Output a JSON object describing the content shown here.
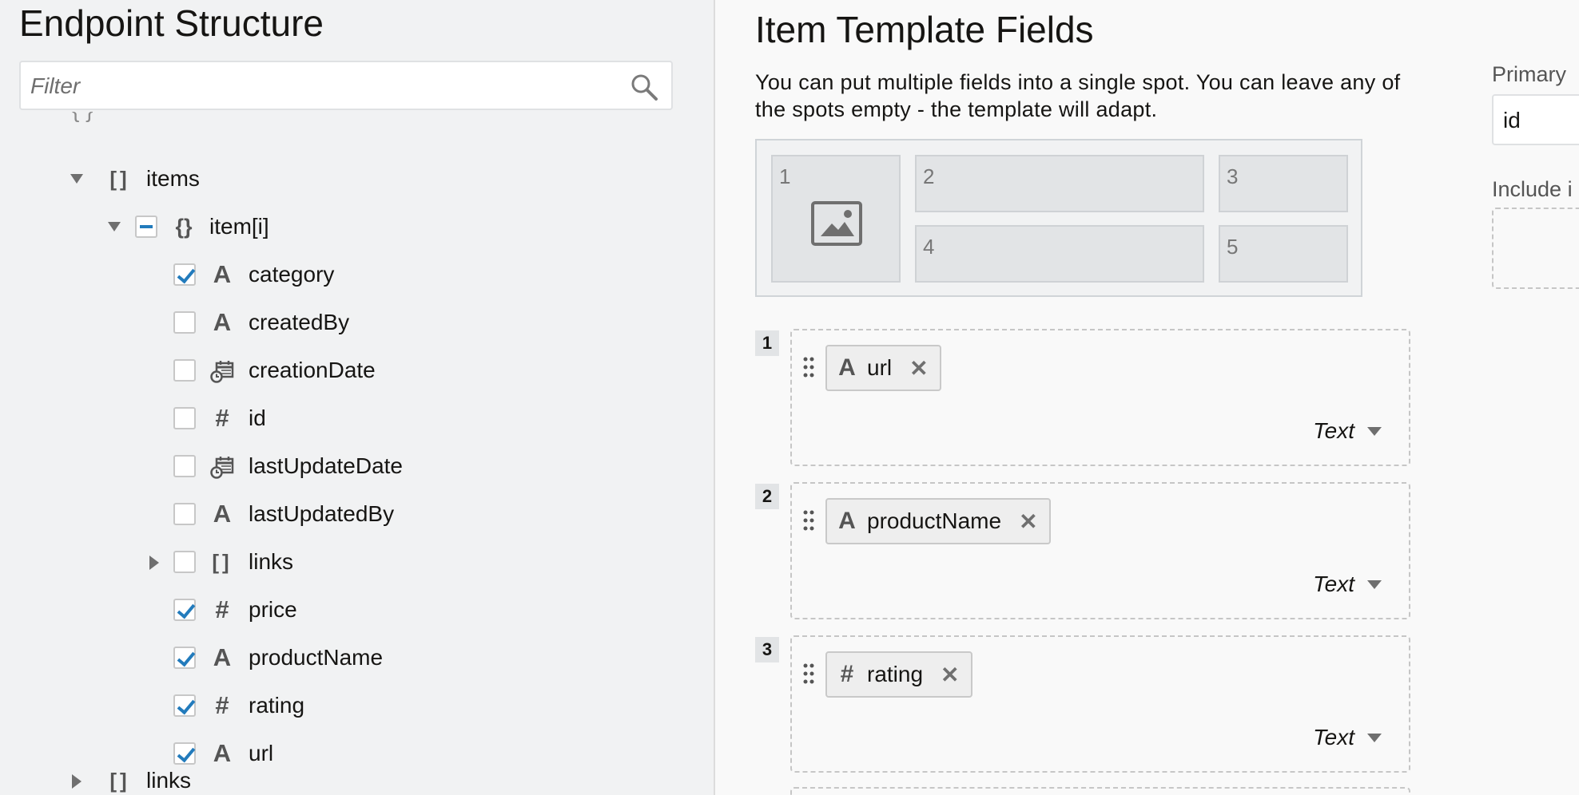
{
  "left_panel": {
    "title": "Endpoint Structure",
    "filter": {
      "placeholder": "Filter",
      "value": ""
    },
    "tree": [
      {
        "label": "items",
        "icon": "array-icon",
        "expander": "expanded",
        "checkbox": "none"
      },
      {
        "label": "item[i]",
        "icon": "object-icon",
        "expander": "expanded",
        "checkbox": "partial"
      },
      {
        "label": "category",
        "icon": "string-icon",
        "expander": "none",
        "checkbox": "checked"
      },
      {
        "label": "createdBy",
        "icon": "string-icon",
        "expander": "none",
        "checkbox": "unchecked"
      },
      {
        "label": "creationDate",
        "icon": "date-icon",
        "expander": "none",
        "checkbox": "unchecked"
      },
      {
        "label": "id",
        "icon": "number-icon",
        "expander": "none",
        "checkbox": "unchecked"
      },
      {
        "label": "lastUpdateDate",
        "icon": "date-icon",
        "expander": "none",
        "checkbox": "unchecked"
      },
      {
        "label": "lastUpdatedBy",
        "icon": "string-icon",
        "expander": "none",
        "checkbox": "unchecked"
      },
      {
        "label": "links",
        "icon": "array-icon",
        "expander": "collapsed",
        "checkbox": "unchecked"
      },
      {
        "label": "price",
        "icon": "number-icon",
        "expander": "none",
        "checkbox": "checked"
      },
      {
        "label": "productName",
        "icon": "string-icon",
        "expander": "none",
        "checkbox": "checked"
      },
      {
        "label": "rating",
        "icon": "number-icon",
        "expander": "none",
        "checkbox": "checked"
      },
      {
        "label": "url",
        "icon": "string-icon",
        "expander": "none",
        "checkbox": "checked"
      },
      {
        "label": "links",
        "icon": "array-icon",
        "expander": "collapsed",
        "checkbox": "none"
      }
    ]
  },
  "template": {
    "title": "Item Template Fields",
    "description": "You can put multiple fields into a single spot. You can leave any of the spots empty - the template will adapt.",
    "spots": [
      "1",
      "2",
      "3",
      "4",
      "5"
    ],
    "fields": [
      {
        "index": "1",
        "field": "url",
        "icon": "string-icon",
        "type_label": "Text"
      },
      {
        "index": "2",
        "field": "productName",
        "icon": "string-icon",
        "type_label": "Text"
      },
      {
        "index": "3",
        "field": "rating",
        "icon": "number-icon",
        "type_label": "Text"
      }
    ]
  },
  "side": {
    "primary_label": "Primary ",
    "primary_value": "id",
    "include_label": "Include i"
  },
  "glyphs": {
    "string": "A",
    "number": "#",
    "array": "[]",
    "object": "{}",
    "remove": "✕"
  },
  "colors": {
    "accent": "#227bbc",
    "text": "#161513",
    "icon": "#555555"
  }
}
